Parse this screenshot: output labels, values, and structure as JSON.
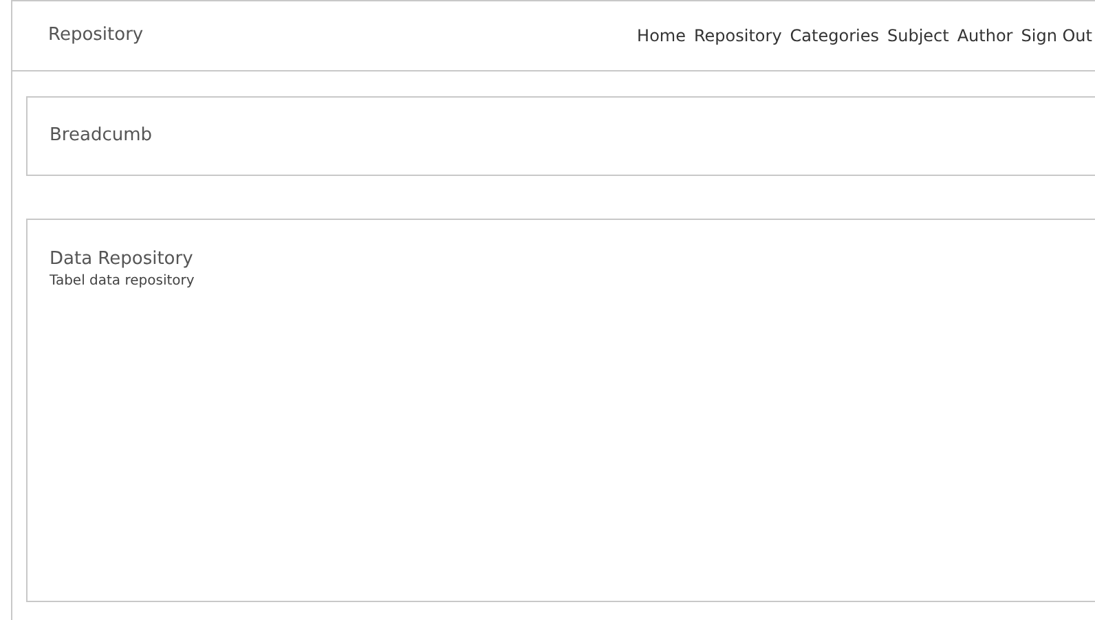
{
  "header": {
    "title": "Repository",
    "nav": [
      "Home",
      "Repository",
      "Categories",
      "Subject",
      "Author",
      "Sign Out"
    ]
  },
  "breadcrumb": {
    "label": "Breadcumb"
  },
  "panel": {
    "title": "Data Repository",
    "subtitle": "Tabel data repository"
  }
}
